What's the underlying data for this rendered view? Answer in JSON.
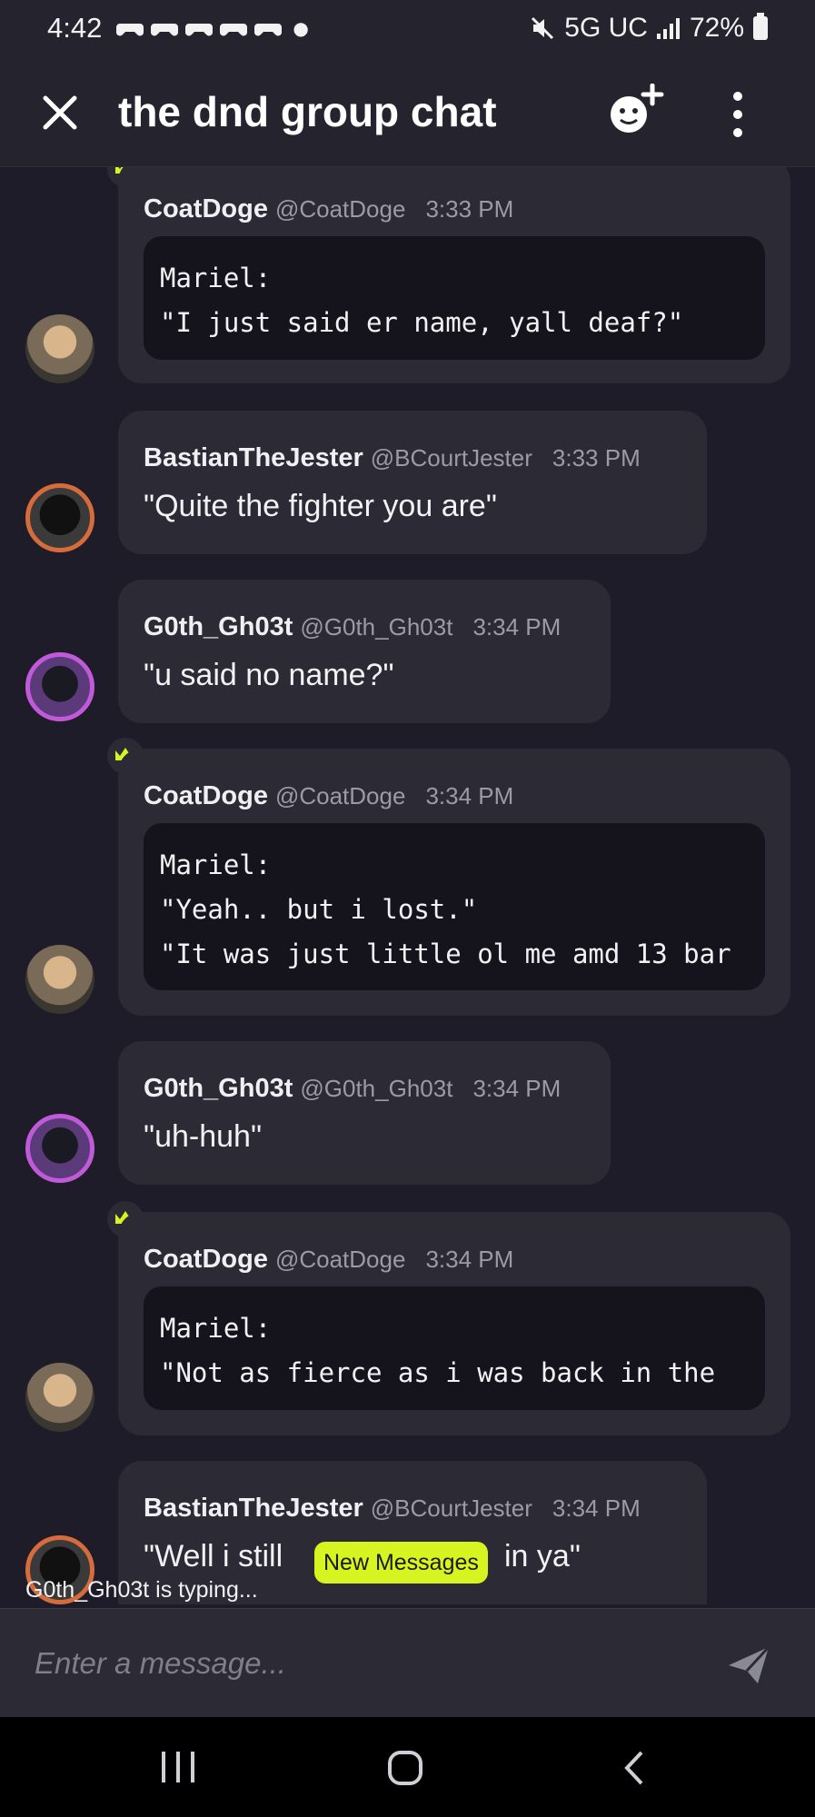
{
  "status_bar": {
    "time": "4:42",
    "signal": "5G UC",
    "battery": "72%"
  },
  "header": {
    "title": "the dnd group chat"
  },
  "messages": [
    {
      "name": "CoatDoge",
      "handle": "@CoatDoge",
      "time": "3:33 PM",
      "code_lines": [
        "Mariel:",
        "\"I just said er name, yall deaf?\""
      ],
      "owner": true
    },
    {
      "name": "BastianTheJester",
      "handle": "@BCourtJester",
      "time": "3:33 PM",
      "text": "\"Quite the fighter you are\""
    },
    {
      "name": "G0th_Gh03t",
      "handle": "@G0th_Gh03t",
      "time": "3:34 PM",
      "text": "\"u said no name?\""
    },
    {
      "name": "CoatDoge",
      "handle": "@CoatDoge",
      "time": "3:34 PM",
      "code_lines": [
        "Mariel:",
        "\"Yeah.. but i lost.\"",
        "\"It was just little ol me amd 13 bar"
      ],
      "owner": true
    },
    {
      "name": "G0th_Gh03t",
      "handle": "@G0th_Gh03t",
      "time": "3:34 PM",
      "text": "\"uh-huh\""
    },
    {
      "name": "CoatDoge",
      "handle": "@CoatDoge",
      "time": "3:34 PM",
      "code_lines": [
        "Mariel:",
        "\"Not as fierce as i was back in the"
      ],
      "owner": true
    },
    {
      "name": "BastianTheJester",
      "handle": "@BCourtJester",
      "time": "3:34 PM",
      "text": "\"Well i still"
    }
  ],
  "last_message_tail": "in ya\"",
  "typing_indicator": "G0th_Gh03t is typing...",
  "new_messages_label": "New Messages",
  "composer": {
    "placeholder": "Enter a message..."
  },
  "colors": {
    "accent": "#d6f520",
    "background": "#1d1c28",
    "bubble": "#2b2a35",
    "code_block": "#15141d"
  }
}
